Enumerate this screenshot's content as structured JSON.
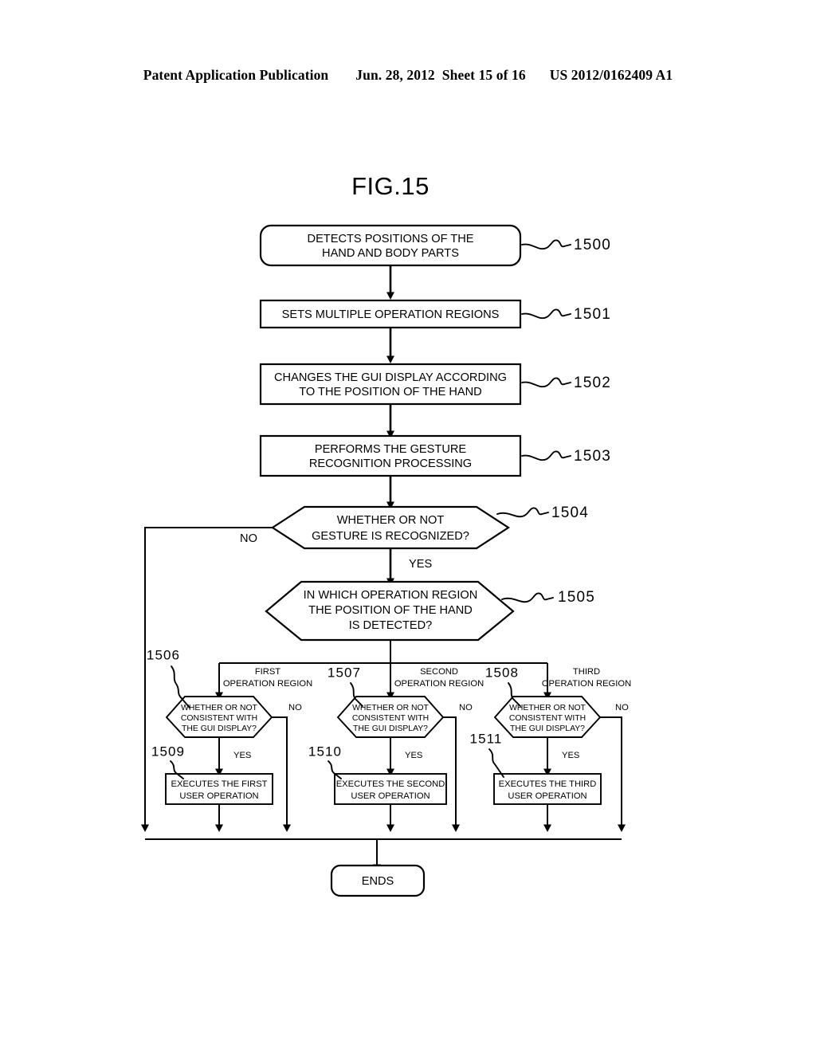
{
  "header": {
    "publication": "Patent Application Publication",
    "date": "Jun. 28, 2012",
    "sheet": "Sheet 15 of 16",
    "docnum": "US 2012/0162409 A1"
  },
  "figure": {
    "title": "FIG.15",
    "nodes": {
      "n1500": {
        "ref": "1500",
        "line1": "DETECTS POSITIONS OF THE",
        "line2": "HAND AND BODY PARTS"
      },
      "n1501": {
        "ref": "1501",
        "line1": "SETS MULTIPLE OPERATION REGIONS"
      },
      "n1502": {
        "ref": "1502",
        "line1": "CHANGES THE GUI DISPLAY ACCORDING",
        "line2": "TO THE POSITION OF THE HAND"
      },
      "n1503": {
        "ref": "1503",
        "line1": "PERFORMS THE GESTURE",
        "line2": "RECOGNITION PROCESSING"
      },
      "n1504": {
        "ref": "1504",
        "line1": "WHETHER OR NOT",
        "line2": "GESTURE IS RECOGNIZED?"
      },
      "n1505": {
        "ref": "1505",
        "line1": "IN WHICH OPERATION REGION",
        "line2": "THE POSITION OF THE HAND",
        "line3": "IS DETECTED?"
      },
      "n1506": {
        "ref": "1506",
        "line1": "WHETHER OR NOT",
        "line2": "CONSISTENT WITH",
        "line3": "THE GUI DISPLAY?"
      },
      "n1507": {
        "ref": "1507",
        "line1": "WHETHER OR NOT",
        "line2": "CONSISTENT WITH",
        "line3": "THE GUI DISPLAY?"
      },
      "n1508": {
        "ref": "1508",
        "line1": "WHETHER OR NOT",
        "line2": "CONSISTENT WITH",
        "line3": "THE GUI DISPLAY?"
      },
      "n1509": {
        "ref": "1509",
        "line1": "EXECUTES THE FIRST",
        "line2": "USER OPERATION"
      },
      "n1510": {
        "ref": "1510",
        "line1": "EXECUTES THE SECOND",
        "line2": "USER OPERATION"
      },
      "n1511": {
        "ref": "1511",
        "line1": "EXECUTES THE THIRD",
        "line2": "USER OPERATION"
      },
      "nend": {
        "line1": "ENDS"
      }
    },
    "edges": {
      "no_1504": "NO",
      "yes_1504": "YES",
      "region_first_l1": "FIRST",
      "region_first_l2": "OPERATION REGION",
      "region_second_l1": "SECOND",
      "region_second_l2": "OPERATION REGION",
      "region_third_l1": "THIRD",
      "region_third_l2": "OPERATION REGION",
      "no_1506": "NO",
      "no_1507": "NO",
      "no_1508": "NO",
      "yes_1506": "YES",
      "yes_1507": "YES",
      "yes_1508": "YES"
    }
  },
  "colors": {
    "ink": "#000000",
    "paper": "#ffffff"
  }
}
